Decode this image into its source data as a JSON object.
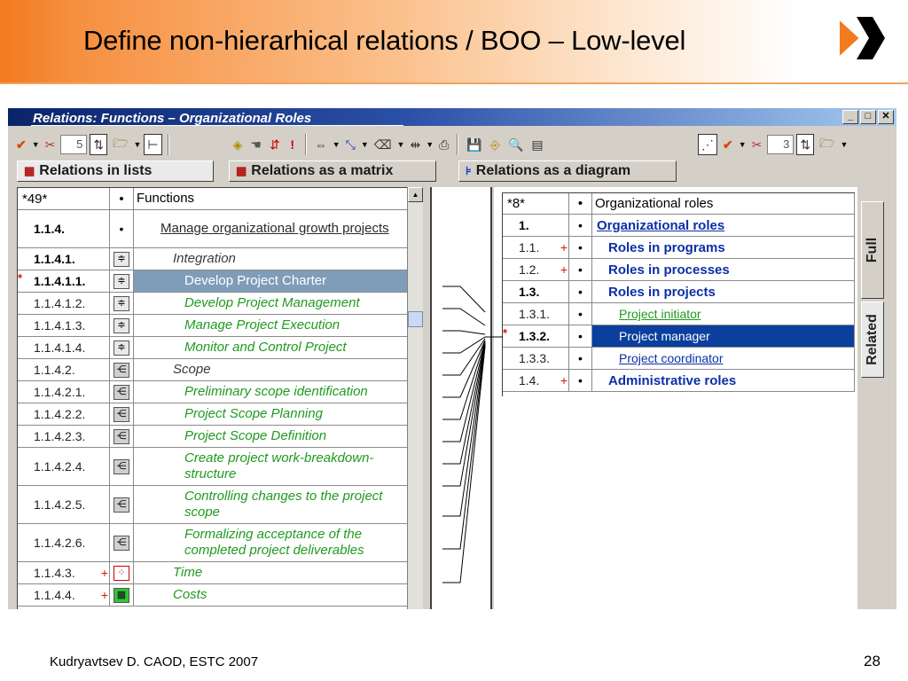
{
  "slide": {
    "title": "Define non-hierarhical relations / BOO – Low-level",
    "footer": "Kudryavtsev D. CAOD, ESTC 2007",
    "page_number": "28",
    "accent_color": "#f27a1f"
  },
  "window": {
    "title": "Relations: Functions – Organizational Roles",
    "buttons": [
      "minimize-icon",
      "maximize-icon",
      "close-icon"
    ]
  },
  "toolbar": {
    "left_spin_value": "5",
    "right_spin_value": "3"
  },
  "tabs": [
    {
      "label": "Relations in lists"
    },
    {
      "label": "Relations as a matrix"
    },
    {
      "label": "Relations as a diagram"
    }
  ],
  "side_tabs": {
    "full": "Full",
    "related": "Related"
  },
  "functions_table": {
    "header": {
      "code": "*49*",
      "icon": "•",
      "name": "Functions"
    },
    "rows": [
      {
        "code": "1.1.4.",
        "name": "Manage organizational growth projects"
      },
      {
        "code": "1.1.4.1.",
        "name": "Integration"
      },
      {
        "code": "1.1.4.1.1.",
        "name": "Develop Project Charter",
        "mark": "*"
      },
      {
        "code": "1.1.4.1.2.",
        "name": "Develop Project Management"
      },
      {
        "code": "1.1.4.1.3.",
        "name": "Manage Project Execution"
      },
      {
        "code": "1.1.4.1.4.",
        "name": "Monitor and Control Project"
      },
      {
        "code": "1.1.4.2.",
        "name": "Scope"
      },
      {
        "code": "1.1.4.2.1.",
        "name": "Preliminary scope identification"
      },
      {
        "code": "1.1.4.2.2.",
        "name": "Project Scope Planning"
      },
      {
        "code": "1.1.4.2.3.",
        "name": "Project Scope Definition"
      },
      {
        "code": "1.1.4.2.4.",
        "name": "Create project work-breakdown-structure"
      },
      {
        "code": "1.1.4.2.5.",
        "name": "Controlling changes to the project scope"
      },
      {
        "code": "1.1.4.2.6.",
        "name": "Formalizing acceptance of the completed project deliverables"
      },
      {
        "code": "1.1.4.3.",
        "name": "Time",
        "plus": "+"
      },
      {
        "code": "1.1.4.4.",
        "name": "Costs",
        "plus": "+"
      }
    ]
  },
  "roles_table": {
    "header": {
      "code": "*8*",
      "icon": "•",
      "name": "Organizational roles"
    },
    "rows": [
      {
        "code": "1.",
        "name": "Organizational roles"
      },
      {
        "code": "1.1.",
        "name": "Roles in programs",
        "plus": "+"
      },
      {
        "code": "1.2.",
        "name": "Roles in processes",
        "plus": "+"
      },
      {
        "code": "1.3.",
        "name": "Roles in projects"
      },
      {
        "code": "1.3.1.",
        "name": "Project initiator"
      },
      {
        "code": "1.3.2.",
        "name": "Project manager",
        "mark": "*"
      },
      {
        "code": "1.3.3.",
        "name": "Project coordinator"
      },
      {
        "code": "1.4.",
        "name": "Administrative roles",
        "plus": "+"
      }
    ]
  },
  "bullet": "•"
}
